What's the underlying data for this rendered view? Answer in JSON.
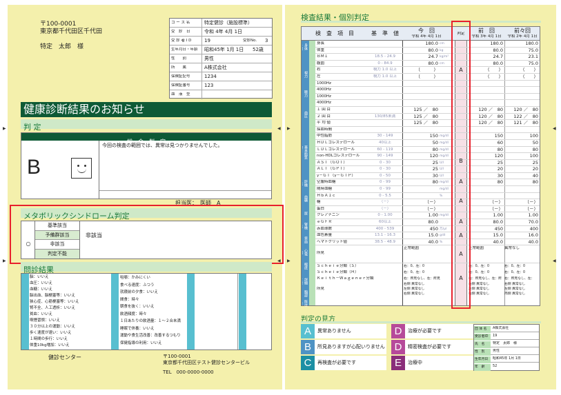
{
  "left": {
    "postal": "〒100-0001",
    "address": "東京都千代田区千代田",
    "recipient": "特定　太郎　様",
    "info": [
      {
        "label": "コ ー ス 名",
        "value": "特定健診（施設標準）"
      },
      {
        "label": "受　診　日",
        "value": "令和 4年 4月 1日"
      },
      {
        "label": "受 診 者 I D",
        "value": "19",
        "extra_label": "受診No.",
        "extra": "3"
      },
      {
        "label": "生年月日・年齢",
        "value": "昭和45年 1月 1日",
        "extra": "52歳"
      },
      {
        "label": "性　　別",
        "value": "男性"
      },
      {
        "label": "所　　属",
        "value": "A株式会社"
      },
      {
        "label": "保険証記号",
        "value": "1234"
      },
      {
        "label": "保険証番号",
        "value": "123"
      },
      {
        "label": "血　液　型",
        "value": ""
      }
    ],
    "banner": "健康診断結果のお知らせ",
    "judgment_title": "判 定",
    "overall_header": "総　合　判　定",
    "overall_grade": "B",
    "overall_comment": "今回の検査の範囲では、異常は見つかりませんでした。",
    "doctor_label": "担当医：",
    "doctor": "医師　A",
    "metabo_title": "メタボリックシンドローム判定",
    "metabo_options": [
      "基準該当",
      "予備群該当",
      "非該当",
      "判定不能"
    ],
    "metabo_mark": "○",
    "metabo_result": "非該当",
    "interview_title": "問診結果",
    "interview_c1_head": [
      "既往歴",
      "",
      "",
      "",
      "服薬",
      "",
      "",
      "",
      "喫煙"
    ],
    "interview_c1": [
      "脳：いいえ",
      "血圧：いいえ",
      "血糖：いいえ",
      "脳出血、脳梗塞等：いいえ",
      "狭心症、心筋梗塞等：いいえ",
      "腎不全、人工透析：いいえ",
      "貧血：いいえ",
      "喫煙習慣：いいえ",
      "３０分以上の運動：いいえ",
      "歩く速度が速い：いいえ",
      "１時間の歩行：いいえ",
      "体重10kg増加：いいえ"
    ],
    "interview_c2": [
      "咀嚼：かみにくい",
      "食べる速度：ふつう",
      "就寝前の夕食：いいえ",
      "間食：時々",
      "朝食を抜く：いいえ",
      "飲酒頻度：時々",
      "１日あたりの飲酒量：１～２合未満",
      "睡眠で休養：いいえ",
      "運動や食生活改善：改善するつもり（６か月以内）",
      "保健指導の利用：いいえ"
    ],
    "interview_c3_head": [
      "自覚症状",
      "",
      "",
      "他覚所見"
    ],
    "interview_c4_head": [
      "その他の既往歴"
    ],
    "center": "健診センター",
    "center_postal": "〒100-0001",
    "center_address": "東京都千代田区テスト健診センタービル",
    "center_tel": "TEL　000-0000-0000"
  },
  "right": {
    "title": "検査結果・個別判定",
    "col_headers": {
      "item": "検　査　項　目",
      "standard": "基　準　値",
      "current": "今　回",
      "current_date": "令和 4年 4月 1日",
      "judge": "判定",
      "prev": "前　回",
      "prev_date": "令和 3年 4月 1日",
      "prev2": "前々回",
      "prev2_date": "令和 2年 4月 1日"
    },
    "categories": [
      "身体計測",
      "視力",
      "聴力",
      "血圧",
      "基本的な健診",
      "脂質",
      "肝機能",
      "血糖",
      "尿",
      "腎機能",
      "貧血",
      "心電図",
      "眼底",
      "詳細な健診",
      "胸部",
      "既往歴"
    ],
    "rows": [
      {
        "item": "身長",
        "std": "",
        "cur": "180.0",
        "unit": "cm",
        "p1": "180.0",
        "p2": "180.0"
      },
      {
        "item": "体重",
        "std": "",
        "cur": "80.0",
        "unit": "kg",
        "p1": "80.0",
        "p2": "75.0"
      },
      {
        "item": "ＢＭＩ",
        "std": "18.5 - 24.9",
        "cur": "24.7",
        "unit": "kg/m²",
        "p1": "24.7",
        "p2": "23.1"
      },
      {
        "item": "腹囲",
        "std": "0 - 84.9",
        "cur": "80.0",
        "unit": "cm",
        "p1": "80.0",
        "p2": "75.0"
      },
      {
        "item": "右",
        "std": "視力 1.0 以上",
        "cur": "（　　　）",
        "unit": "",
        "p1": "（　　）",
        "p2": "（　　）"
      },
      {
        "item": "左",
        "std": "視力 1.0 以上",
        "cur": "（　　　）",
        "unit": "",
        "p1": "（　　）",
        "p2": "（　　）"
      },
      {
        "item": "1000Hz",
        "std": "",
        "cur": "",
        "unit": "",
        "p1": "",
        "p2": ""
      },
      {
        "item": "4000Hz",
        "std": "",
        "cur": "",
        "unit": "",
        "p1": "",
        "p2": ""
      },
      {
        "item": "1000Hz",
        "std": "",
        "cur": "",
        "unit": "",
        "p1": "",
        "p2": ""
      },
      {
        "item": "4000Hz",
        "std": "",
        "cur": "",
        "unit": "",
        "p1": "",
        "p2": ""
      },
      {
        "item": "１ 回 目",
        "std": "",
        "cur": "125 ／　80",
        "unit": "",
        "p1": "120 ／　80",
        "p2": "120 ／　80"
      },
      {
        "item": "２ 回 目",
        "std": "130/85未満",
        "cur": "125 ／　80",
        "unit": "",
        "p1": "120 ／　80",
        "p2": "122 ／　80"
      },
      {
        "item": "平 均 値",
        "std": "",
        "cur": "125 ／　80",
        "unit": "",
        "p1": "120 ／　80",
        "p2": "121 ／　80"
      },
      {
        "item": "採血時間",
        "std": "",
        "cur": "",
        "unit": "",
        "p1": "",
        "p2": ""
      },
      {
        "item": "中性脂肪",
        "std": "30 - 149",
        "cur": "150",
        "unit": "mg/dl",
        "p1": "150",
        "p2": "100"
      },
      {
        "item": "ＨＤＬコレステロール",
        "std": "40以上",
        "cur": "50",
        "unit": "mg/dl",
        "p1": "60",
        "p2": "50"
      },
      {
        "item": "ＬＤＬコレステロール",
        "std": "60 - 119",
        "cur": "80",
        "unit": "mg/dl",
        "p1": "80",
        "p2": "80"
      },
      {
        "item": "non-HDLコレステロール",
        "std": "90 - 149",
        "cur": "120",
        "unit": "mg/dl",
        "p1": "120",
        "p2": "100"
      },
      {
        "item": "ＡＳＴ（ＧＯＴ）",
        "std": "0 - 30",
        "cur": "25",
        "unit": "U/l",
        "p1": "25",
        "p2": "25"
      },
      {
        "item": "ＡＬＴ（ＧＰＴ）",
        "std": "0 - 30",
        "cur": "25",
        "unit": "U/l",
        "p1": "20",
        "p2": "20"
      },
      {
        "item": "γ－ＧＴ（γ－ＧＴＰ）",
        "std": "0 - 50",
        "cur": "30",
        "unit": "U/l",
        "p1": "30",
        "p2": "40"
      },
      {
        "item": "空腹時血糖",
        "std": "0 - 99",
        "cur": "80",
        "unit": "mg/dl",
        "p1": "80",
        "p2": "80"
      },
      {
        "item": "随時血糖",
        "std": "0 - 99",
        "cur": "",
        "unit": "mg/dl",
        "p1": "",
        "p2": ""
      },
      {
        "item": "ＨｂＡ１ｃ",
        "std": "0 - 5.5",
        "cur": "",
        "unit": "%",
        "p1": "",
        "p2": ""
      },
      {
        "item": "糖",
        "std": "（－）",
        "cur": "（－）",
        "unit": "",
        "p1": "（－）",
        "p2": "（－）"
      },
      {
        "item": "蛋白",
        "std": "（－）",
        "cur": "（－）",
        "unit": "",
        "p1": "（－）",
        "p2": "（－）"
      },
      {
        "item": "クレアチニン",
        "std": "0 - 1.00",
        "cur": "1.00",
        "unit": "mg/dl",
        "p1": "1.00",
        "p2": "1.00"
      },
      {
        "item": "ｅＧＦＲ",
        "std": "60以上",
        "cur": "80.0",
        "unit": "",
        "p1": "80.0",
        "p2": "70.0"
      },
      {
        "item": "赤血球数",
        "std": "400 - 539",
        "cur": "450",
        "unit": "万/μl",
        "p1": "450",
        "p2": "400"
      },
      {
        "item": "血色素量",
        "std": "13.1 - 16.3",
        "cur": "15.0",
        "unit": "g/dl",
        "p1": "15.0",
        "p2": "16.0"
      },
      {
        "item": "ヘマトクリット値",
        "std": "38.5 - 48.9",
        "cur": "40.0",
        "unit": "%",
        "p1": "40.0",
        "p2": "40.0"
      }
    ],
    "judges": [
      "A",
      "B",
      "A",
      "A",
      "A",
      "A",
      "A",
      "A"
    ],
    "ecg_item": "所見",
    "ecg_cur": "正常範囲",
    "ecg_p1": "正常範囲",
    "ecg_p2": "異常なし",
    "fundus_items": [
      "Ｓｃｈｅｉｅ分類（Ｓ）",
      "Ｓｃｈｅｉｅ分類（Ｈ）",
      "Ｋｅｉｔｈ－Ｗａｇｅｎｅｒ分類"
    ],
    "fundus_cur": [
      "右：0、左：0",
      "右：0、左：0",
      "右：所見なし、左：所見"
    ],
    "fundus_p1": [
      "右：0、左：0",
      "右：0、左：0",
      "右：所見なし、左：所"
    ],
    "fundus_p2": [
      "右：0、左：0",
      "右：0、左：0",
      "右：所見なし、左："
    ],
    "chest_item": "所見",
    "chest_cur": [
      "右側 異常なし",
      "左側 異常なし",
      "右側 異常なし"
    ],
    "chest_p1": [
      "右側 異常なし",
      "左側 異常なし",
      "右側 異常なし"
    ],
    "chest_p2": [
      "右側 異常なし",
      "左側 異常なし",
      "両側 異常なし"
    ],
    "legend_title": "判定の見方",
    "legend": [
      {
        "code": "A",
        "text": "異常ありません",
        "color": "#58bfd0"
      },
      {
        "code": "B",
        "text": "所見ありますが心配いりません",
        "color": "#4f93c4"
      },
      {
        "code": "C",
        "text": "再検査が必要です",
        "color": "#1c8fa4"
      },
      {
        "code": "D",
        "text": "治療が必要です",
        "color": "#b64a9a"
      },
      {
        "code": "D",
        "text": "精密検査が必要です",
        "color": "#b64a9a"
      },
      {
        "code": "E",
        "text": "治療中",
        "color": "#8a2e7a"
      }
    ],
    "summary": [
      {
        "label": "団 体 名",
        "value": "A株式会社"
      },
      {
        "label": "受診者ID",
        "value": "19"
      },
      {
        "label": "氏　名",
        "value": "特定　太郎　様"
      },
      {
        "label": "性　別",
        "value": "男性"
      },
      {
        "label": "生年月日",
        "value": "昭和45年 1月 1日"
      },
      {
        "label": "年　齢",
        "value": "52"
      }
    ]
  },
  "colors": {
    "page": "#f4f0ac",
    "green": "#0e5a36",
    "lightgreen": "#b9e1b7",
    "blue": "#4f93c4",
    "cyan": "#58bfd0",
    "highlight": "#e8202c"
  }
}
